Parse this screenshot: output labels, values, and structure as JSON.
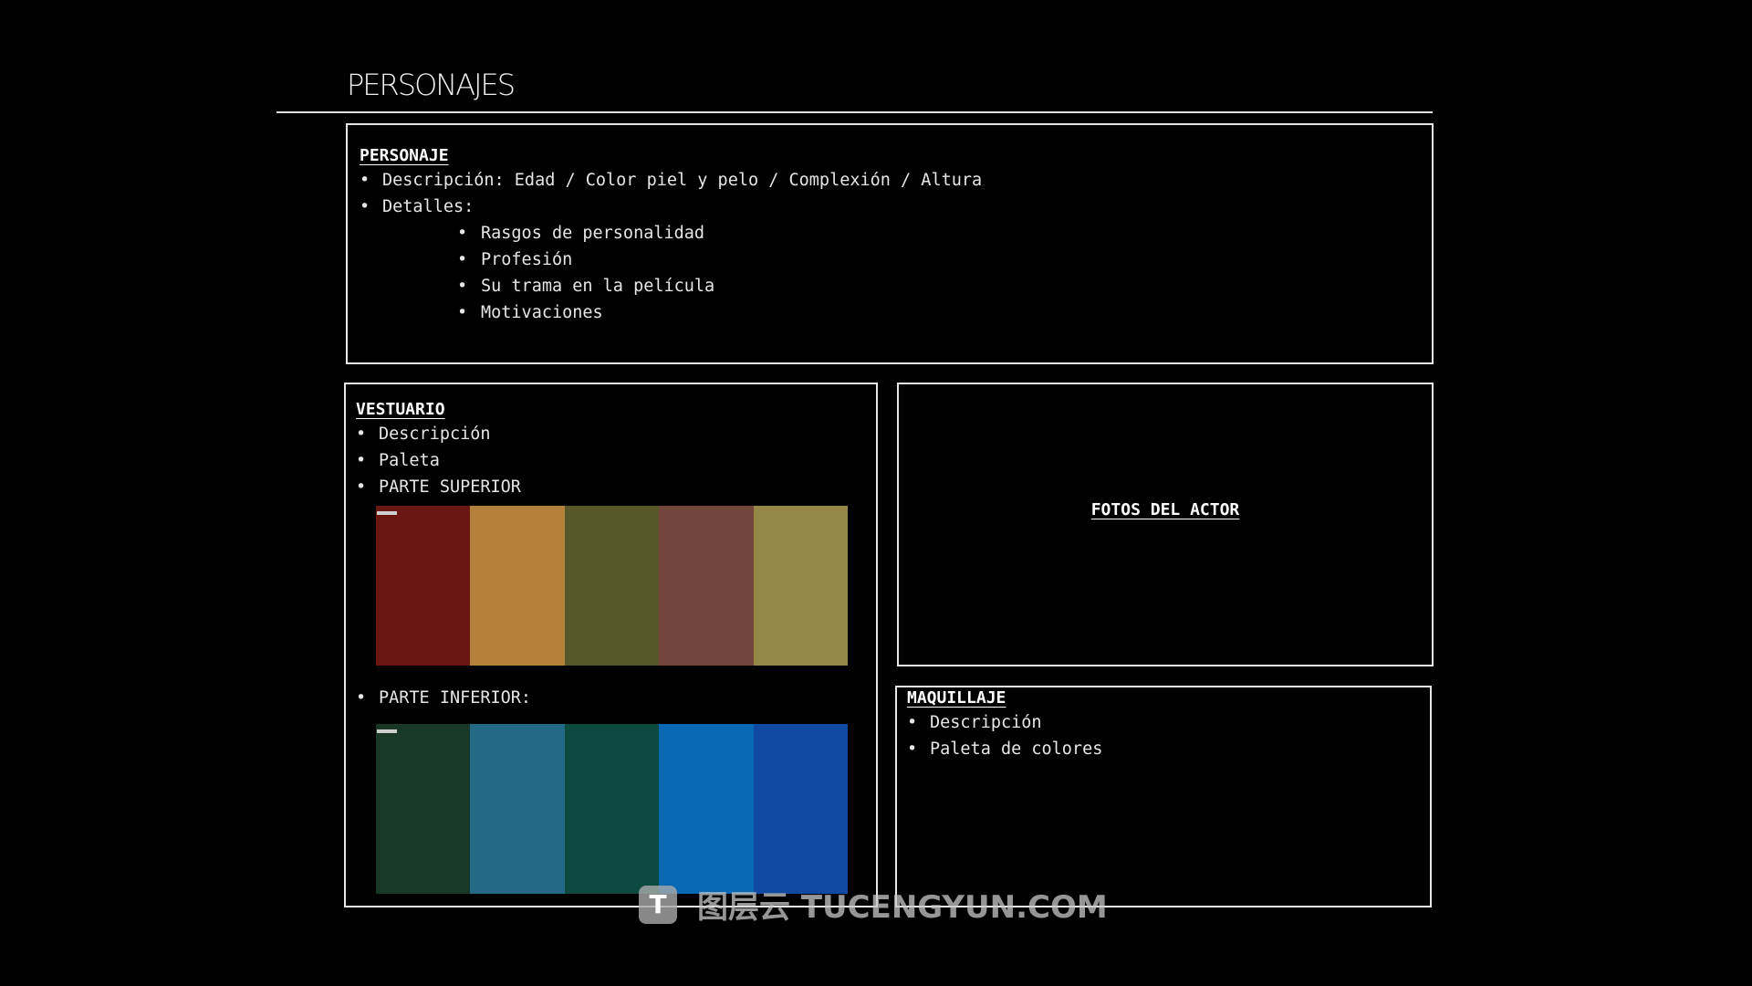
{
  "title": "PERSONAJES",
  "personaje": {
    "heading": "PERSONAJE",
    "items": [
      "Descripción: Edad / Color piel y pelo / Complexión / Altura",
      "Detalles:"
    ],
    "details": [
      "Rasgos de personalidad",
      "Profesión",
      "Su trama en la película",
      "Motivaciones"
    ]
  },
  "vestuario": {
    "heading": "VESTUARIO",
    "items": [
      "Descripción",
      "Paleta",
      "PARTE SUPERIOR"
    ],
    "inferior_label": "PARTE INFERIOR:",
    "palette_top": [
      "#6a1612",
      "#b4813a",
      "#575727",
      "#74463b",
      "#948747"
    ],
    "palette_bottom": [
      "#1a3826",
      "#246a87",
      "#0c4a3f",
      "#0967b4",
      "#0f49a1"
    ]
  },
  "fotos": {
    "heading": "FOTOS DEL ACTOR"
  },
  "maquillaje": {
    "heading": "MAQUILLAJE",
    "items": [
      "Descripción",
      "Paleta de colores"
    ]
  },
  "watermark": {
    "logo": "T",
    "text": "图层云 TUCENGYUN.COM"
  }
}
